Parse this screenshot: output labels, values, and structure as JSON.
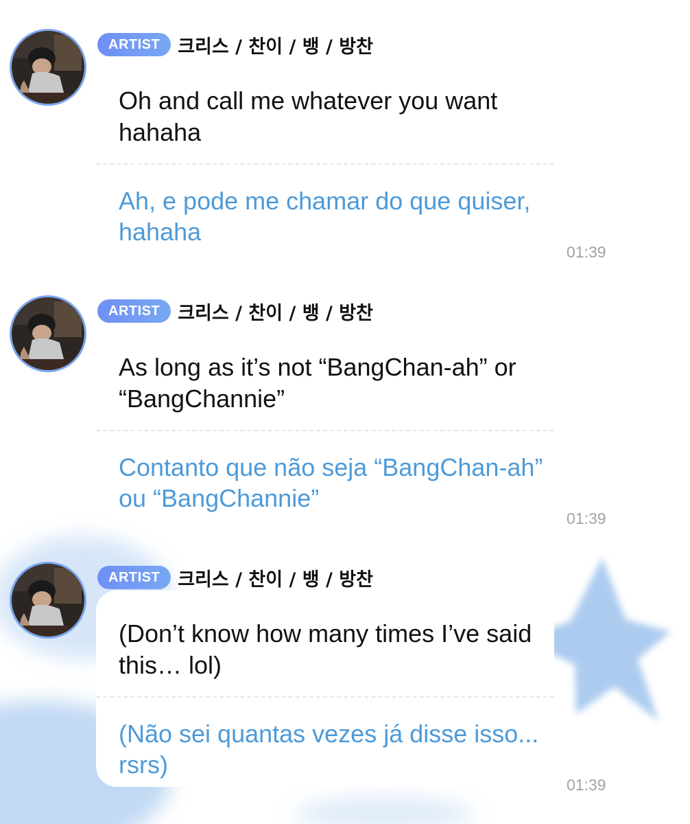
{
  "messages": [
    {
      "badge": "ARTIST",
      "author": "크리스 / 찬이 / 뱅 / 방찬",
      "original": "Oh and call me whatever you want hahaha",
      "translation": "Ah, e pode me chamar do que quiser, hahaha",
      "time": "01:39"
    },
    {
      "badge": "ARTIST",
      "author": "크리스 / 찬이 / 뱅 / 방찬",
      "original": "As long as it’s not “BangChan-ah” or “BangChannie”",
      "translation": "Contanto que não seja “BangChan-ah” ou “BangChannie”",
      "time": "01:39"
    },
    {
      "badge": "ARTIST",
      "author": "크리스 / 찬이 / 뱅 / 방찬",
      "original": "(Don’t know how many times I’ve said this… lol)",
      "translation": "(Não sei quantas vezes já disse isso... rsrs)",
      "time": "01:39"
    }
  ],
  "colors": {
    "badge": "#6f8ff5",
    "translation": "#4d9ad8",
    "avatar_ring": "#7aa7f0",
    "decor": "#a9c9ef"
  }
}
